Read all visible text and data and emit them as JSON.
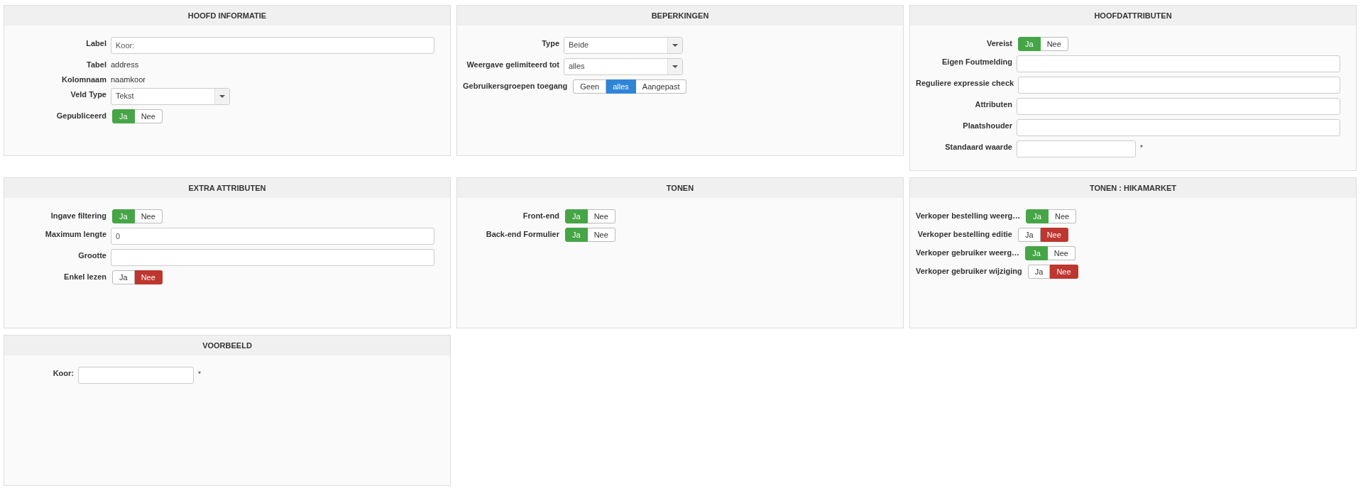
{
  "panels": [
    {
      "title": "HOOFD INFORMATIE",
      "kind": "form",
      "rows": [
        {
          "label": "Label",
          "kind": "input_wide",
          "value": "Koor:"
        },
        {
          "label": "Tabel",
          "kind": "static",
          "value": "address"
        },
        {
          "label": "Kolomnaam",
          "kind": "static",
          "value": "naamkoor"
        },
        {
          "label": "Veld Type",
          "kind": "select",
          "value": "Tekst"
        },
        {
          "label": "Gepubliceerd",
          "kind": "toggle",
          "options": [
            {
              "label": "Ja",
              "kind": "yes",
              "selected": true
            },
            {
              "label": "Nee",
              "kind": "no",
              "selected": false
            }
          ]
        }
      ]
    },
    {
      "title": "BEPERKINGEN",
      "kind": "form",
      "rows": [
        {
          "label": "Type",
          "kind": "select",
          "value": "Beide"
        },
        {
          "label": "Weergave gelimiteerd tot",
          "kind": "select",
          "value": "alles"
        },
        {
          "label": "Gebruikersgroepen toegang",
          "kind": "toggle",
          "options": [
            {
              "label": "Geen",
              "kind": "neutral",
              "selected": false
            },
            {
              "label": "alles",
              "kind": "neutral",
              "selected": true
            },
            {
              "label": "Aangepast",
              "kind": "neutral",
              "selected": false
            }
          ]
        }
      ]
    },
    {
      "title": "HOOFDATTRIBUTEN",
      "kind": "form",
      "rows": [
        {
          "label": "Vereist",
          "kind": "toggle",
          "options": [
            {
              "label": "Ja",
              "kind": "yes",
              "selected": true
            },
            {
              "label": "Nee",
              "kind": "no",
              "selected": false
            }
          ]
        },
        {
          "label": "Eigen Foutmelding",
          "kind": "input_wide"
        },
        {
          "label": "Reguliere expressie check",
          "kind": "input_wide"
        },
        {
          "label": "Attributen",
          "kind": "input_wide"
        },
        {
          "label": "Plaatshouder",
          "kind": "input_wide"
        },
        {
          "label": "Standaard waarde",
          "kind": "input_short",
          "suffix": "*"
        }
      ]
    },
    {
      "title": "EXTRA ATTRIBUTEN",
      "kind": "form",
      "rows": [
        {
          "label": "Ingave filtering",
          "kind": "toggle",
          "options": [
            {
              "label": "Ja",
              "kind": "yes",
              "selected": true
            },
            {
              "label": "Nee",
              "kind": "no",
              "selected": false
            }
          ]
        },
        {
          "label": "Maximum lengte",
          "kind": "input_wide",
          "value": "0"
        },
        {
          "label": "Grootte",
          "kind": "input_wide"
        },
        {
          "label": "Enkel lezen",
          "kind": "toggle",
          "options": [
            {
              "label": "Ja",
              "kind": "yes",
              "selected": false
            },
            {
              "label": "Nee",
              "kind": "no",
              "selected": true
            }
          ]
        }
      ]
    },
    {
      "title": "TONEN",
      "kind": "form",
      "rows": [
        {
          "label": "Front-end",
          "kind": "toggle",
          "options": [
            {
              "label": "Ja",
              "kind": "yes",
              "selected": true
            },
            {
              "label": "Nee",
              "kind": "no",
              "selected": false
            }
          ]
        },
        {
          "label": "Back-end Formulier",
          "kind": "toggle",
          "options": [
            {
              "label": "Ja",
              "kind": "yes",
              "selected": true
            },
            {
              "label": "Nee",
              "kind": "no",
              "selected": false
            }
          ]
        }
      ]
    },
    {
      "title": "TONEN : HIKAMARKET",
      "kind": "form",
      "rows": [
        {
          "label": "Verkoper bestelling weerg…",
          "kind": "toggle",
          "options": [
            {
              "label": "Ja",
              "kind": "yes",
              "selected": true
            },
            {
              "label": "Nee",
              "kind": "no",
              "selected": false
            }
          ]
        },
        {
          "label": "Verkoper bestelling editie",
          "kind": "toggle",
          "options": [
            {
              "label": "Ja",
              "kind": "yes",
              "selected": false
            },
            {
              "label": "Nee",
              "kind": "no",
              "selected": true
            }
          ]
        },
        {
          "label": "Verkoper gebruiker weerg…",
          "kind": "toggle",
          "options": [
            {
              "label": "Ja",
              "kind": "yes",
              "selected": true
            },
            {
              "label": "Nee",
              "kind": "no",
              "selected": false
            }
          ]
        },
        {
          "label": "Verkoper gebruiker wijziging",
          "kind": "toggle",
          "options": [
            {
              "label": "Ja",
              "kind": "yes",
              "selected": false
            },
            {
              "label": "Nee",
              "kind": "no",
              "selected": true
            }
          ]
        }
      ]
    },
    {
      "title": "VOORBEELD",
      "kind": "preview",
      "rows": [
        {
          "label": "Koor:",
          "kind": "input_short",
          "suffix": "*"
        }
      ]
    }
  ]
}
